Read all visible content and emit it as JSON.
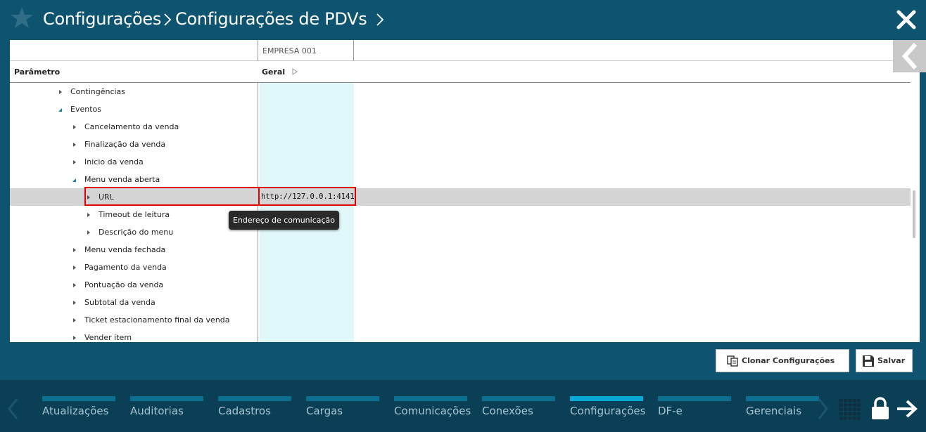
{
  "header": {
    "breadcrumb": [
      "Configurações",
      "Configurações de PDVs"
    ]
  },
  "table": {
    "company_header": "EMPRESA 001",
    "param_header": "Parâmetro",
    "group_header": "Geral",
    "rows": [
      {
        "label": "Contingências",
        "expanded": false,
        "value": ""
      },
      {
        "label": "Eventos",
        "expanded": true,
        "value": ""
      },
      {
        "label": "Cancelamento da venda",
        "expanded": false,
        "value": ""
      },
      {
        "label": "Finalização da venda",
        "expanded": false,
        "value": ""
      },
      {
        "label": "Inicio da venda",
        "expanded": false,
        "value": ""
      },
      {
        "label": "Menu venda aberta",
        "expanded": true,
        "value": ""
      },
      {
        "label": "URL",
        "expanded": false,
        "value": "http://127.0.0.1:4141",
        "selected": true
      },
      {
        "label": "Timeout de leitura",
        "expanded": false,
        "value": ""
      },
      {
        "label": "Descrição do menu",
        "expanded": false,
        "value": ""
      },
      {
        "label": "Menu venda fechada",
        "expanded": false,
        "value": ""
      },
      {
        "label": "Pagamento da venda",
        "expanded": false,
        "value": ""
      },
      {
        "label": "Pontuação da venda",
        "expanded": false,
        "value": ""
      },
      {
        "label": "Subtotal da venda",
        "expanded": false,
        "value": ""
      },
      {
        "label": "Ticket estacionamento final da venda",
        "expanded": false,
        "value": ""
      },
      {
        "label": "Vender item",
        "expanded": false,
        "value": ""
      }
    ],
    "tooltip": "Endereço de comunicação"
  },
  "actions": {
    "clone_label": "Clonar Configurações",
    "save_label": "Salvar"
  },
  "footer": {
    "tabs": [
      {
        "label": "Atualizações",
        "active": false
      },
      {
        "label": "Auditorias",
        "active": false
      },
      {
        "label": "Cadastros",
        "active": false
      },
      {
        "label": "Cargas",
        "active": false
      },
      {
        "label": "Comunicações",
        "active": false
      },
      {
        "label": "Conexões",
        "active": false
      },
      {
        "label": "Configurações",
        "active": true
      },
      {
        "label": "DF-e",
        "active": false
      },
      {
        "label": "Gerenciais",
        "active": false
      }
    ]
  },
  "colors": {
    "header_bg": "#0e5470",
    "footer_bg": "#0a3f56",
    "value_col_bg": "#e0f8fa",
    "selected_row_bg": "#d4d4d4",
    "highlight_border": "#e00000",
    "active_tab_bar": "#0aa8d6",
    "tab_bar": "#0d6f8f"
  },
  "icons": {
    "header": "star-icon",
    "close": "close-icon",
    "collapse": "chevron-left-icon",
    "clone": "copy-icon",
    "save": "floppy-icon",
    "apps": "grid-icon",
    "lock": "lock-icon",
    "logout": "arrow-right-icon"
  }
}
